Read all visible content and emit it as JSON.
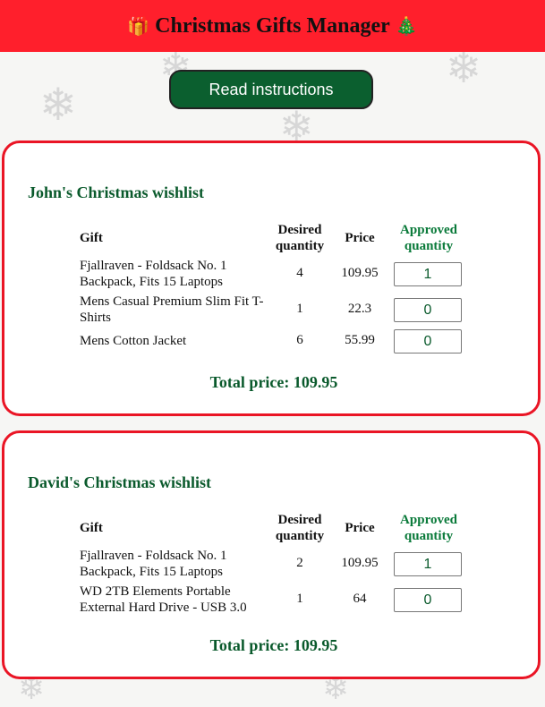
{
  "app": {
    "title": "Christmas Gifts Manager",
    "gift_icon": "gift-icon",
    "tree_icon": "christmas-tree-icon",
    "read_button": "Read instructions"
  },
  "columns": {
    "gift": "Gift",
    "desired_line1": "Desired",
    "desired_line2": "quantity",
    "price": "Price",
    "approved_line1": "Approved",
    "approved_line2": "quantity"
  },
  "wishlists": [
    {
      "title": "John's Christmas wishlist",
      "items": [
        {
          "gift": "Fjallraven - Foldsack No. 1 Backpack, Fits 15 Laptops",
          "desired": "4",
          "price": "109.95",
          "approved": "1"
        },
        {
          "gift": "Mens Casual Premium Slim Fit T-Shirts",
          "desired": "1",
          "price": "22.3",
          "approved": "0"
        },
        {
          "gift": "Mens Cotton Jacket",
          "desired": "6",
          "price": "55.99",
          "approved": "0"
        }
      ],
      "total": "Total price: 109.95"
    },
    {
      "title": "David's Christmas wishlist",
      "items": [
        {
          "gift": "Fjallraven - Foldsack No. 1 Backpack, Fits 15 Laptops",
          "desired": "2",
          "price": "109.95",
          "approved": "1"
        },
        {
          "gift": "WD 2TB Elements Portable External Hard Drive - USB 3.0",
          "desired": "1",
          "price": "64",
          "approved": "0"
        }
      ],
      "total": "Total price: 109.95"
    }
  ],
  "colors": {
    "header_bg": "#ff1f2c",
    "button_bg": "#0b5f2f",
    "card_border": "#ea1525",
    "accent_green": "#0a5a2c"
  }
}
